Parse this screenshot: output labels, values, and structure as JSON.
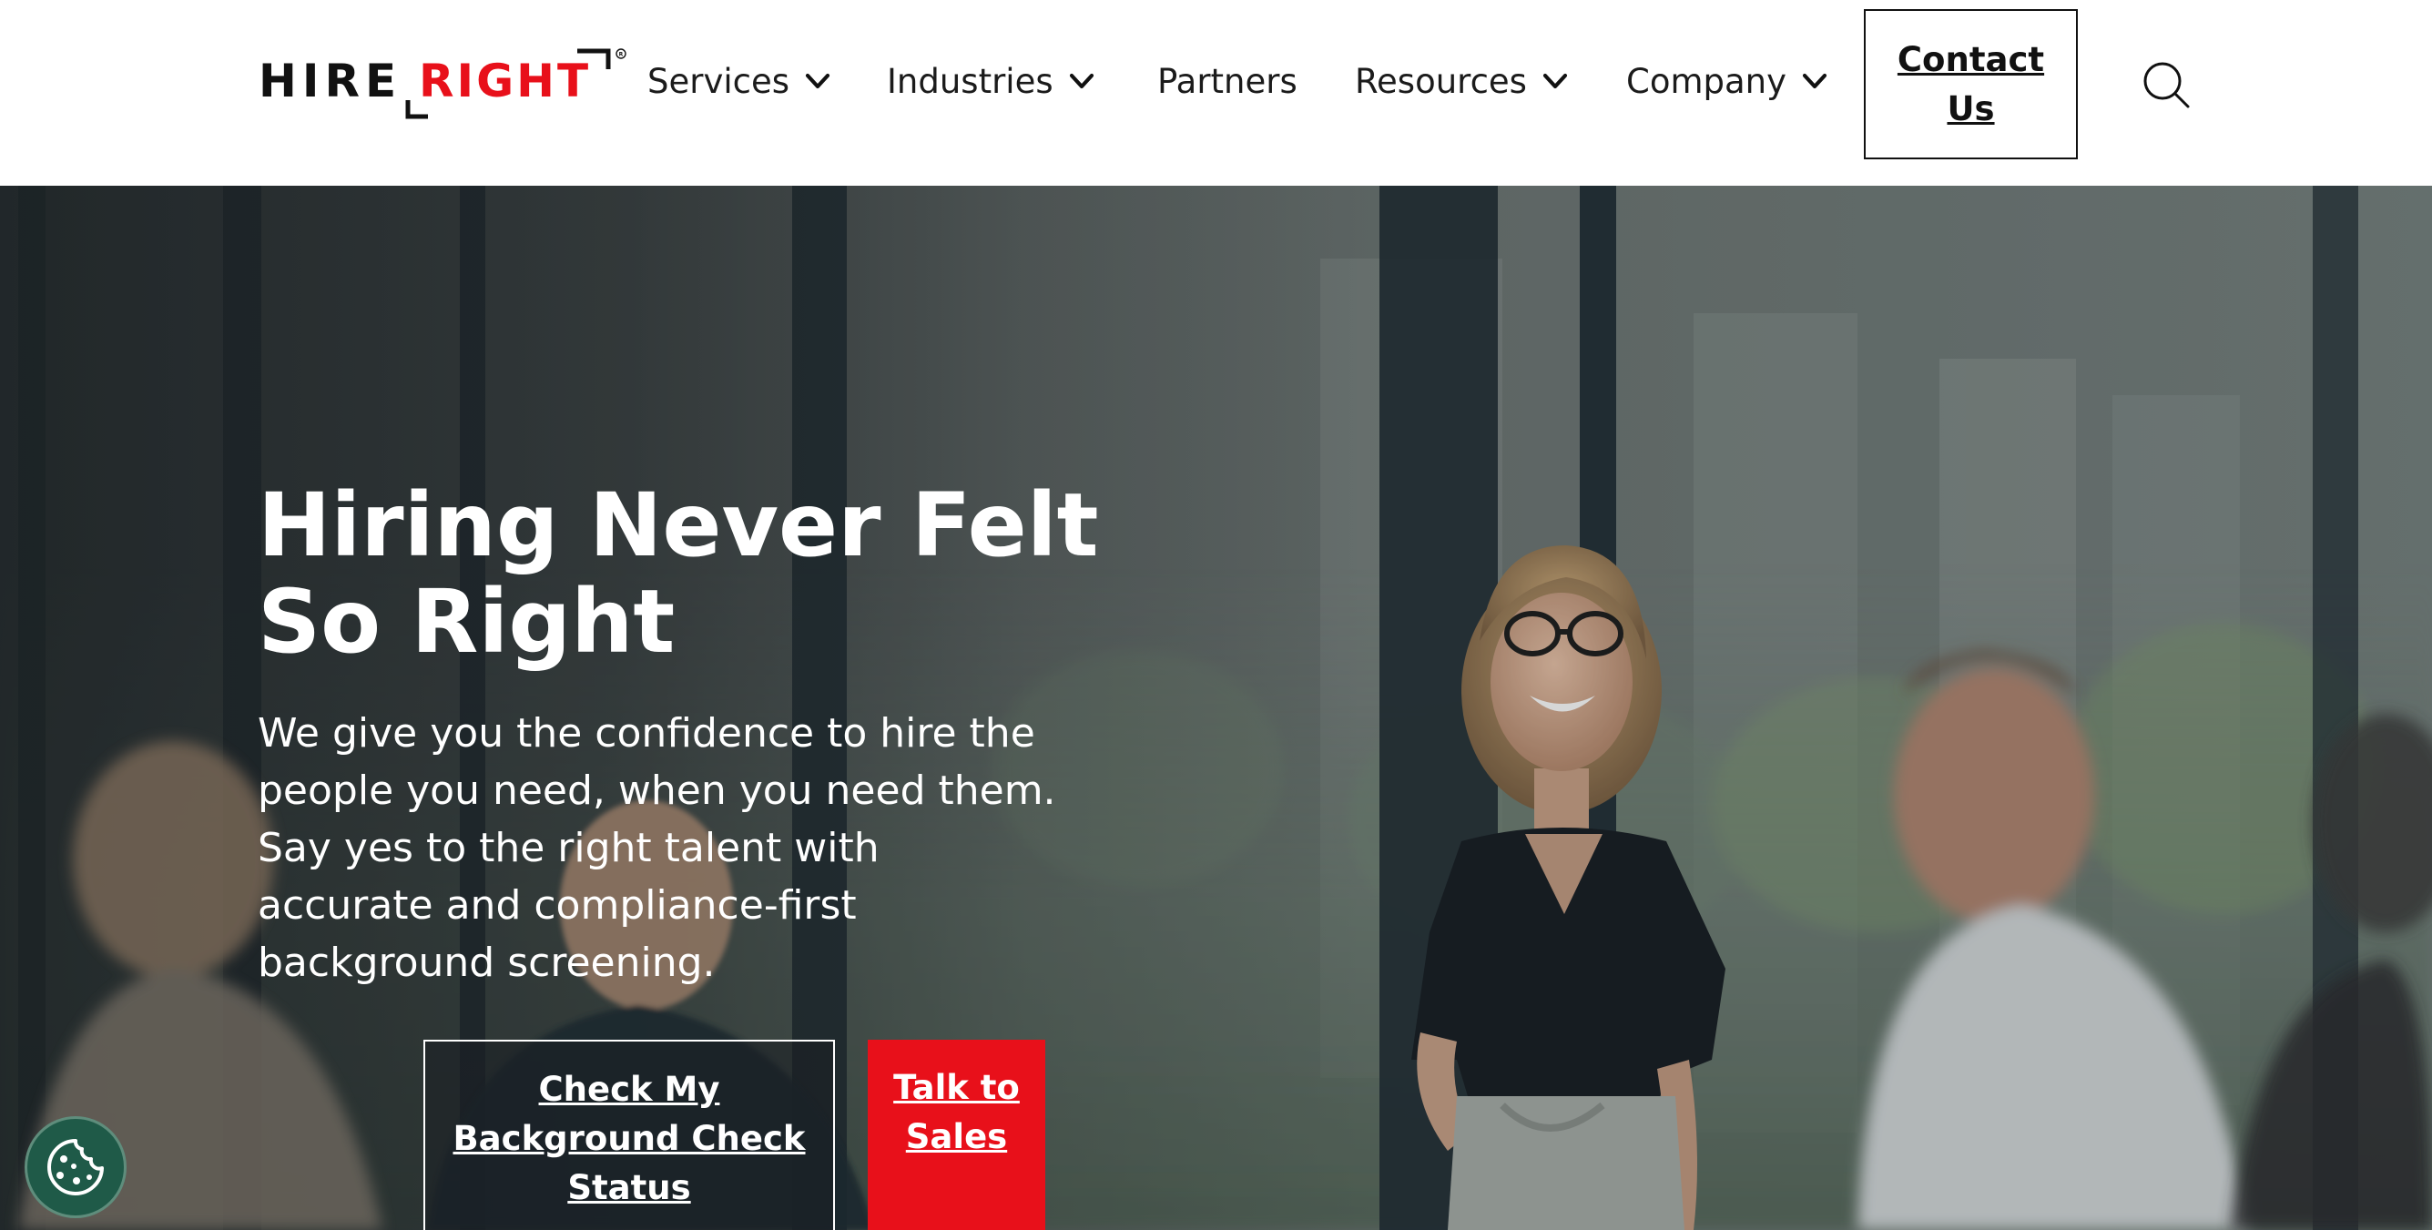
{
  "brand": {
    "logo_text_left": "HIRE",
    "logo_text_right": "RIGHT",
    "logo_mark": "®",
    "accent_color": "#e8101a",
    "text_color": "#111111"
  },
  "nav": {
    "items": [
      {
        "label": "Services",
        "has_dropdown": true,
        "icon": "chevron-down-icon"
      },
      {
        "label": "Industries",
        "has_dropdown": true,
        "icon": "chevron-down-icon"
      },
      {
        "label": "Partners",
        "has_dropdown": false
      },
      {
        "label": "Resources",
        "has_dropdown": true,
        "icon": "chevron-down-icon"
      },
      {
        "label": "Company",
        "has_dropdown": true,
        "icon": "chevron-down-icon"
      }
    ],
    "contact_label": "Contact Us",
    "search_icon": "search-icon"
  },
  "hero": {
    "title": "Hiring Never Felt So Right",
    "text": "We give you the confidence to hire the people you need, when you need them. Say yes to the right talent with accurate and compliance-first background screening.",
    "btn_status_label": "Check My Background Check Status",
    "btn_sales_label": "Talk to Sales",
    "btn_sales_color": "#e8101a"
  },
  "cookie": {
    "icon": "cookie-icon",
    "color": "#1f5a48"
  }
}
